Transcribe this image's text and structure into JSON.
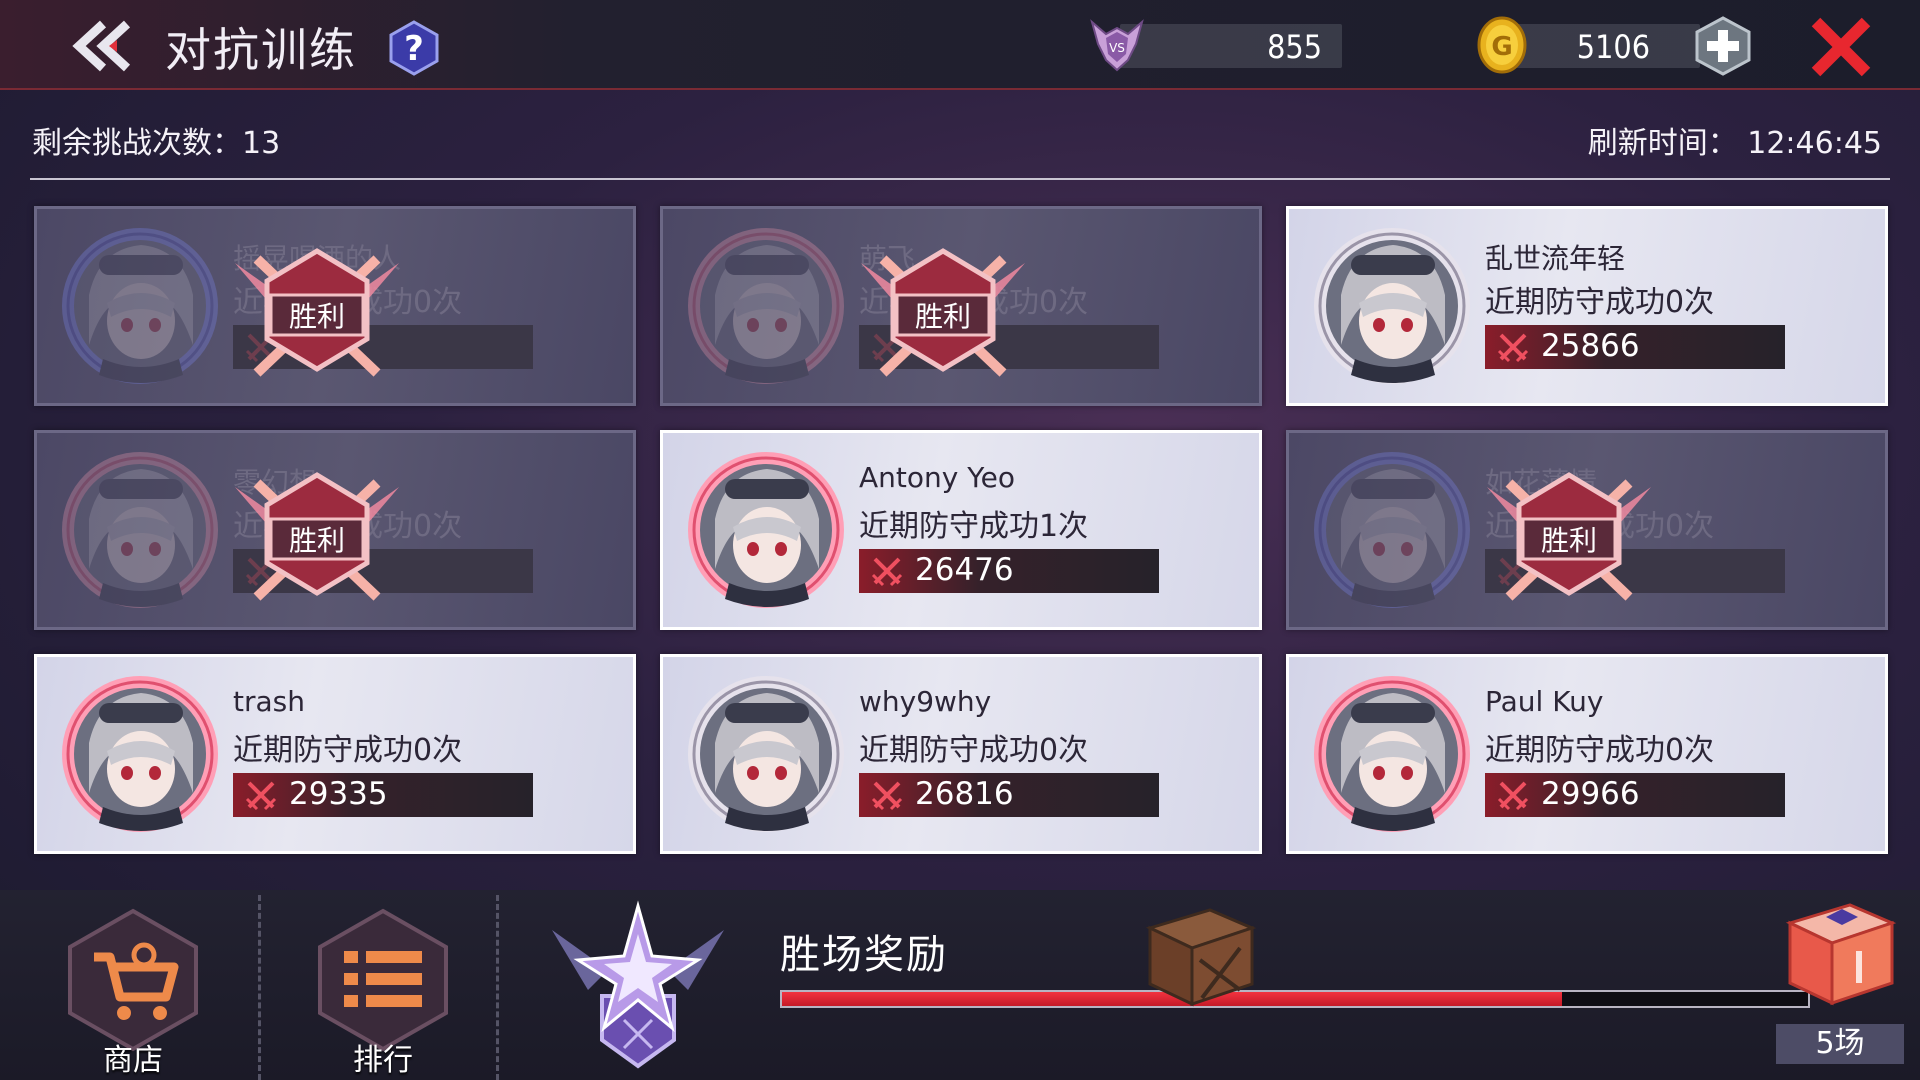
{
  "header": {
    "title": "对抗训练",
    "medal_value": "855",
    "coin_value": "5106"
  },
  "status": {
    "remaining_label": "剩余挑战次数：13",
    "refresh_label": "刷新时间： 12:46:45"
  },
  "opponents": [
    {
      "name": "摇晃喝酒的人",
      "defense": "近期防守成功0次",
      "power": "",
      "won": true,
      "ring": "blue"
    },
    {
      "name": "萌飞",
      "defense": "近期防守成功0次",
      "power": "",
      "won": true,
      "ring": "pink"
    },
    {
      "name": "乱世流年轻",
      "defense": "近期防守成功0次",
      "power": "25866",
      "won": false,
      "ring": "plain"
    },
    {
      "name": "零幻想",
      "defense": "近期防守成功0次",
      "power": "",
      "won": true,
      "ring": "pink"
    },
    {
      "name": "Antony Yeo",
      "defense": "近期防守成功1次",
      "power": "26476",
      "won": false,
      "ring": "pink"
    },
    {
      "name": "如花薄情",
      "defense": "近期防守成功0次",
      "power": "",
      "won": true,
      "ring": "blue"
    },
    {
      "name": "trash",
      "defense": "近期防守成功0次",
      "power": "29335",
      "won": false,
      "ring": "pink"
    },
    {
      "name": "why9why",
      "defense": "近期防守成功0次",
      "power": "26816",
      "won": false,
      "ring": "plain"
    },
    {
      "name": "Paul Kuy",
      "defense": "近期防守成功0次",
      "power": "29966",
      "won": false,
      "ring": "pink"
    }
  ],
  "victory_label": "胜利",
  "bottom": {
    "shop_label": "商店",
    "rank_label": "排行",
    "reward_title": "胜场奖励",
    "reward_progress": 0.76,
    "games_badge": "5场"
  },
  "colors": {
    "accent_red": "#e52a37",
    "card_bg": "#e1e1ee",
    "won_card_bg": "#514d6a"
  }
}
